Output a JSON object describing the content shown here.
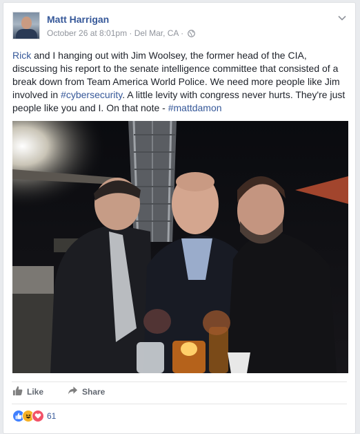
{
  "post": {
    "author": "Matt Harrigan",
    "timestamp": "October 26 at 8:01pm",
    "separator": " · ",
    "location": "Del Mar, CA",
    "separator2": " · ",
    "privacy_icon": "globe-icon",
    "menu_icon": "chevron-down-icon",
    "message": {
      "mention": "Rick",
      "text_1": " and I hanging out with Jim Woolsey, the former head of the CIA, discussing his report to the senate intelligence committee that consisted of a break down from Team America World Police. We need more people like Jim involved in ",
      "hashtag_1": "#cybersecurity",
      "text_2": ". A little levity with congress never hurts. They're just people like you and I. On that note - ",
      "hashtag_2": "#mattdamon"
    }
  },
  "actions": {
    "like_label": "Like",
    "share_label": "Share"
  },
  "reactions": {
    "icons": [
      "like-icon",
      "haha-icon",
      "love-icon"
    ],
    "count": "61",
    "colors": {
      "like": "#4080ff",
      "haha": "#f7b125",
      "love": "#f25268"
    }
  }
}
